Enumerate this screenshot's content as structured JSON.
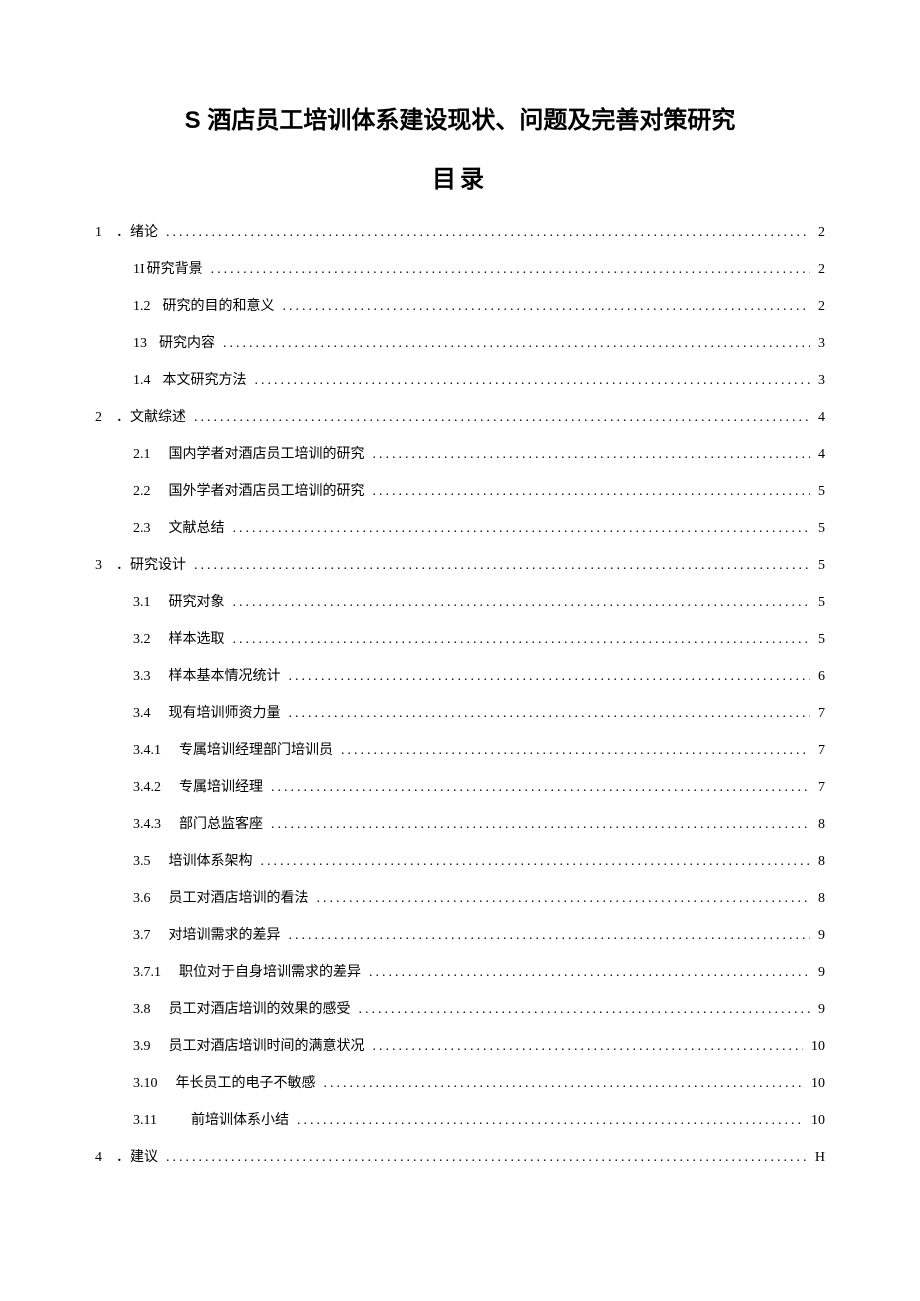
{
  "title": "S 酒店员工培训体系建设现状、问题及完善对策研究",
  "subtitle": "目录",
  "toc": [
    {
      "level": 1,
      "num": "1",
      "text": "．绪论",
      "page": "2"
    },
    {
      "level": 2,
      "num": "1I",
      "text": "研究背景",
      "page": "2",
      "nospace": true
    },
    {
      "level": 2,
      "num": "1.2",
      "text": "研究的目的和意义",
      "page": "2"
    },
    {
      "level": 2,
      "num": "13",
      "text": "研究内容",
      "page": "3"
    },
    {
      "level": 2,
      "num": "1.4",
      "text": "本文研究方法",
      "page": "3"
    },
    {
      "level": 1,
      "num": "2",
      "text": "．文献综述",
      "page": "4"
    },
    {
      "level": 2,
      "num": "2.1",
      "text": "国内学者对酒店员工培训的研究",
      "page": "4",
      "gap": true
    },
    {
      "level": 2,
      "num": "2.2",
      "text": "国外学者对酒店员工培训的研究",
      "page": "5",
      "gap": true
    },
    {
      "level": 2,
      "num": "2.3",
      "text": "文献总结",
      "page": "5",
      "gap": true
    },
    {
      "level": 1,
      "num": "3",
      "text": "．研究设计",
      "page": "5"
    },
    {
      "level": 2,
      "num": "3.1",
      "text": "研究对象",
      "page": "5",
      "gap": true
    },
    {
      "level": 2,
      "num": "3.2",
      "text": "样本选取",
      "page": "5",
      "gap": true
    },
    {
      "level": 2,
      "num": "3.3",
      "text": "样本基本情况统计",
      "page": "6",
      "gap": true
    },
    {
      "level": 2,
      "num": "3.4",
      "text": "现有培训师资力量",
      "page": "7",
      "gap": true
    },
    {
      "level": 2,
      "num": "3.4.1",
      "text": "专属培训经理部门培训员",
      "page": "7",
      "gap": true
    },
    {
      "level": 2,
      "num": "3.4.2",
      "text": "专属培训经理",
      "page": "7",
      "gap": true
    },
    {
      "level": 2,
      "num": "3.4.3",
      "text": "部门总监客座",
      "page": "8",
      "gap": true
    },
    {
      "level": 2,
      "num": "3.5",
      "text": "培训体系架构",
      "page": "8",
      "gap": true
    },
    {
      "level": 2,
      "num": "3.6",
      "text": "员工对酒店培训的看法",
      "page": "8",
      "gap": true
    },
    {
      "level": 2,
      "num": "3.7",
      "text": "对培训需求的差异",
      "page": "9",
      "gap": true
    },
    {
      "level": 2,
      "num": "3.7.1",
      "text": "职位对于自身培训需求的差异",
      "page": "9",
      "gap": true
    },
    {
      "level": 2,
      "num": "3.8",
      "text": "员工对酒店培训的效果的感受",
      "page": "9",
      "gap": true
    },
    {
      "level": 2,
      "num": "3.9",
      "text": "员工对酒店培训时间的满意状况",
      "page": "10",
      "gap": true
    },
    {
      "level": 2,
      "num": "3.10",
      "text": "年长员工的电子不敏感",
      "page": "10",
      "gap": true
    },
    {
      "level": 2,
      "num": "3.11",
      "text": "前培训体系小结",
      "page": "10",
      "biggap": true
    },
    {
      "level": 1,
      "num": "4",
      "text": "．建议",
      "page": "H"
    }
  ]
}
